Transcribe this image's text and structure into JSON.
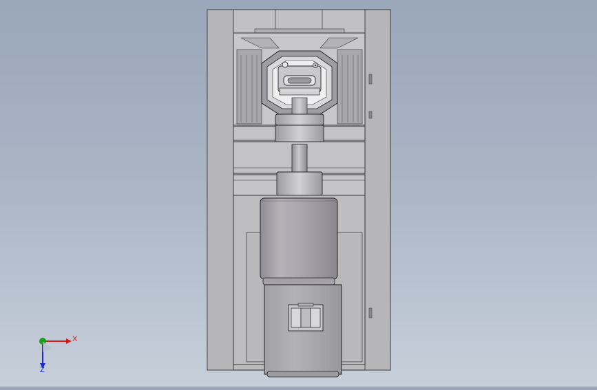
{
  "viewport": {
    "name": "cad-3d-viewport",
    "background_top": "#9aa7ba",
    "background_bottom": "#c7cfda"
  },
  "model": {
    "frame_color": "#b9b9bd",
    "line_color": "#2a2a2a",
    "motor_color": "#a9a6ac"
  },
  "triad": {
    "x_label": "X",
    "z_label": "Z",
    "x_color": "#d11a1a",
    "y_color": "#18a018",
    "z_color": "#1a2ad1"
  }
}
